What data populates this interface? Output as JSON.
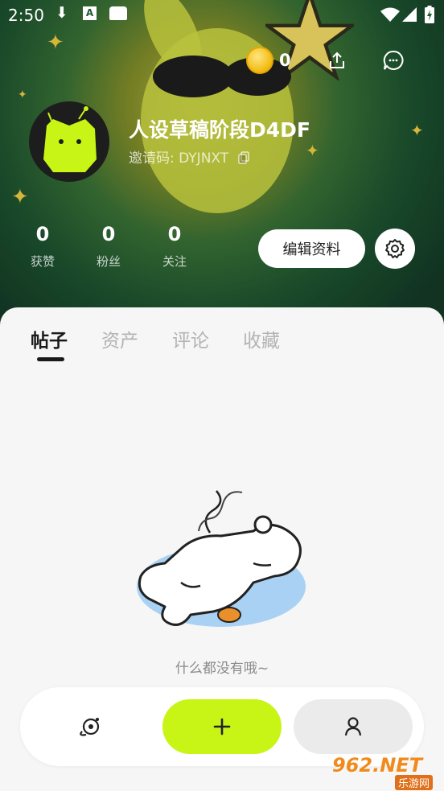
{
  "status_bar": {
    "time": "2:50"
  },
  "header": {
    "coin_count": "0"
  },
  "profile": {
    "username": "人设草稿阶段D4DF",
    "invite_code": "邀请码: DYJNXT"
  },
  "stats": [
    {
      "value": "0",
      "label": "获赞"
    },
    {
      "value": "0",
      "label": "粉丝"
    },
    {
      "value": "0",
      "label": "关注"
    }
  ],
  "actions": {
    "edit_label": "编辑资料"
  },
  "tabs": [
    {
      "label": "帖子",
      "active": true
    },
    {
      "label": "资产",
      "active": false
    },
    {
      "label": "评论",
      "active": false
    },
    {
      "label": "收藏",
      "active": false
    }
  ],
  "empty_state": {
    "message": "什么都没有哦~"
  },
  "bottom_nav": {
    "items": [
      {
        "icon": "planet-icon",
        "active": false
      },
      {
        "icon": "plus-icon",
        "active": true
      },
      {
        "icon": "person-icon",
        "active": false
      }
    ]
  },
  "watermark": {
    "text": "962.NET",
    "subtext": "乐游网"
  },
  "colors": {
    "accent": "#c8f515",
    "hero_dark": "#1f5a33",
    "background": "#f6f6f6"
  }
}
